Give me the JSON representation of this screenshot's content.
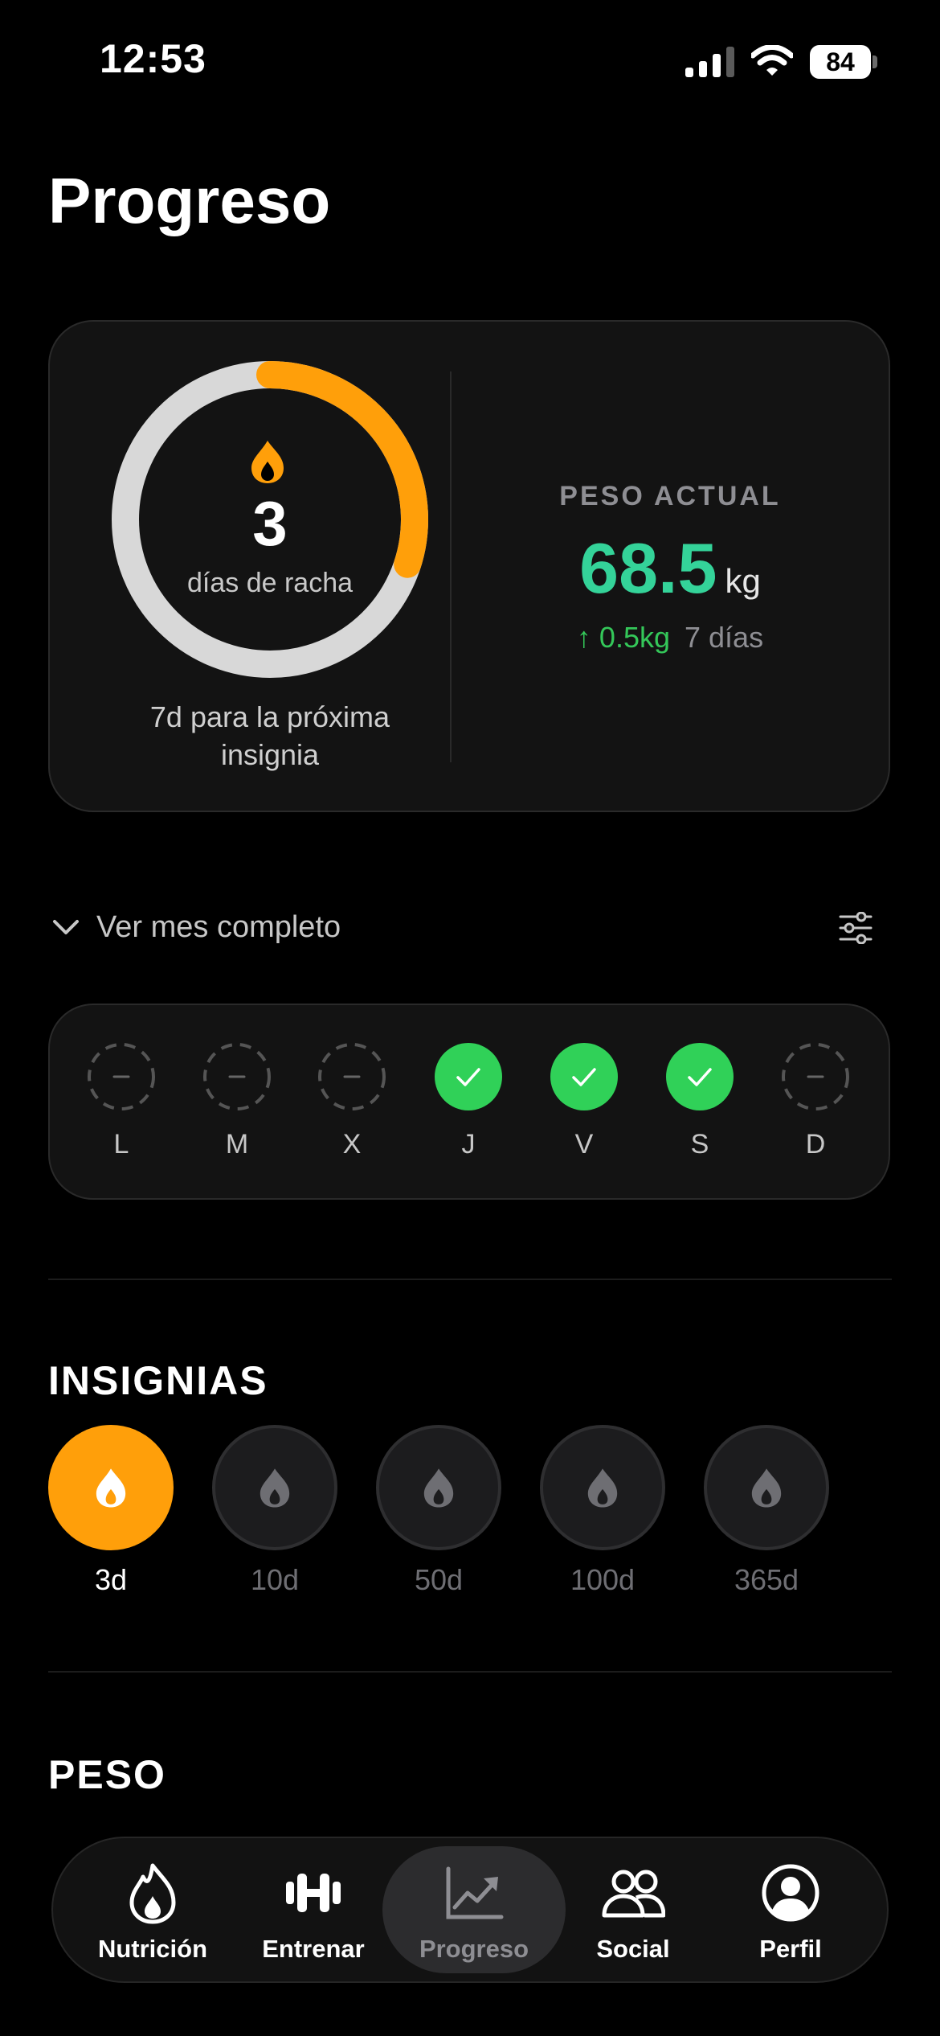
{
  "status_bar": {
    "time": "12:53",
    "battery": "84"
  },
  "page": {
    "title": "Progreso"
  },
  "streak": {
    "days": "3",
    "label": "días de racha",
    "progress": 0.3,
    "next_badge": "7d para la próxima insignia",
    "ring_color": "#ff9f0a",
    "icon": "flame-icon"
  },
  "weight": {
    "label": "PESO ACTUAL",
    "value": "68.5",
    "unit": "kg",
    "delta": "↑ 0.5kg",
    "period": "7 días",
    "value_color": "#34d399"
  },
  "month": {
    "toggle_label": "Ver mes completo",
    "icon": "chevron-down-icon",
    "filter_icon": "sliders-icon"
  },
  "week": {
    "days": [
      {
        "label": "L",
        "done": false
      },
      {
        "label": "M",
        "done": false
      },
      {
        "label": "X",
        "done": false
      },
      {
        "label": "J",
        "done": true
      },
      {
        "label": "V",
        "done": true
      },
      {
        "label": "S",
        "done": true
      },
      {
        "label": "D",
        "done": false
      }
    ],
    "done_color": "#30d158"
  },
  "badges": {
    "title": "INSIGNIAS",
    "items": [
      {
        "label": "3d",
        "unlocked": true
      },
      {
        "label": "10d",
        "unlocked": false
      },
      {
        "label": "50d",
        "unlocked": false
      },
      {
        "label": "100d",
        "unlocked": false
      },
      {
        "label": "365d",
        "unlocked": false
      }
    ]
  },
  "weight_section": {
    "title": "PESO"
  },
  "tabs": [
    {
      "label": "Nutrición",
      "icon": "flame-icon",
      "active": false
    },
    {
      "label": "Entrenar",
      "icon": "dumbbell-icon",
      "active": false
    },
    {
      "label": "Progreso",
      "icon": "chart-icon",
      "active": true
    },
    {
      "label": "Social",
      "icon": "people-icon",
      "active": false
    },
    {
      "label": "Perfil",
      "icon": "profile-icon",
      "active": false
    }
  ]
}
